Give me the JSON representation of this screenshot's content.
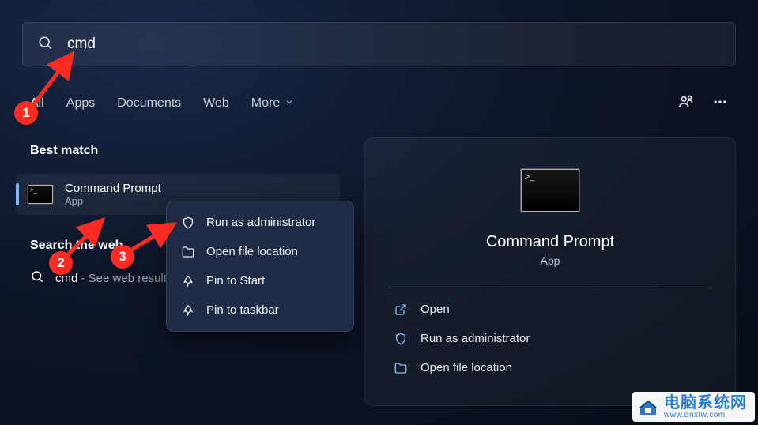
{
  "search": {
    "value": "cmd"
  },
  "tabs": {
    "items": [
      {
        "label": "All",
        "active": true
      },
      {
        "label": "Apps",
        "active": false
      },
      {
        "label": "Documents",
        "active": false
      },
      {
        "label": "Web",
        "active": false
      },
      {
        "label": "More",
        "active": false,
        "chevron": true
      }
    ]
  },
  "left": {
    "section_title": "Best match",
    "best_match": {
      "title": "Command Prompt",
      "subtitle": "App"
    },
    "subsection_title": "Search the web",
    "web_result": {
      "query": "cmd",
      "suffix": " - See web results"
    }
  },
  "right_panel": {
    "title": "Command Prompt",
    "subtitle": "App",
    "actions": [
      {
        "icon": "open",
        "label": "Open"
      },
      {
        "icon": "shield",
        "label": "Run as administrator"
      },
      {
        "icon": "folder",
        "label": "Open file location"
      }
    ]
  },
  "context_menu": {
    "items": [
      {
        "icon": "shield",
        "label": "Run as administrator"
      },
      {
        "icon": "folder",
        "label": "Open file location"
      },
      {
        "icon": "pin",
        "label": "Pin to Start"
      },
      {
        "icon": "pin",
        "label": "Pin to taskbar"
      }
    ]
  },
  "annotations": {
    "badges": [
      "1",
      "2",
      "3"
    ]
  },
  "watermark": {
    "title_cn": "电脑系统网",
    "url": "www.dnxtw.com"
  }
}
